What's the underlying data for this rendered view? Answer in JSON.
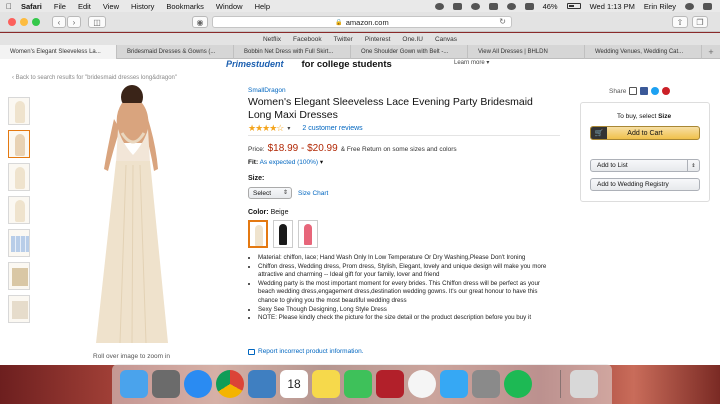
{
  "menubar": {
    "app": "Safari",
    "items": [
      "File",
      "Edit",
      "View",
      "History",
      "Bookmarks",
      "Window",
      "Help"
    ],
    "battery": "46%",
    "clock": "Wed 1:13 PM",
    "user": "Erin Riley"
  },
  "toolbar": {
    "address": "amazon.com"
  },
  "favorites": [
    "Netflix",
    "Facebook",
    "Twitter",
    "Pinterest",
    "One.IU",
    "Canvas"
  ],
  "tabs": [
    "Women's Elegant Sleeveless La...",
    "Bridesmaid Dresses & Gowns (...",
    "Bobbin Net Dress with Full Skirt...",
    "One Shoulder Gown with Belt -...",
    "View All Dresses | BHLDN",
    "Wedding Venues, Wedding Cat..."
  ],
  "page": {
    "prime_logo": "Primestudent",
    "prime_tagline": "for college students",
    "learn_more": "Learn more ▾",
    "back_link": "‹ Back to search results for \"bridesmaid dresses long&dragon\"",
    "zoom_hint": "Roll over image to zoom in",
    "brand": "SmallDragon",
    "title": "Women's Elegant Sleeveless Lace Evening Party Bridesmaid Long Maxi Dresses",
    "stars": "★★★★☆",
    "reviews": "2 customer reviews",
    "price_label": "Price:",
    "price": "$18.99 - $20.99",
    "shipping": "& Free Return on some sizes and colors",
    "fit_label": "Fit:",
    "fit_value": "As expected (100%)",
    "size_label": "Size:",
    "size_select": "Select",
    "size_chart": "Size Chart",
    "color_label": "Color:",
    "color_value": "Beige",
    "swatch_colors": [
      "#efe3cd",
      "#1a1a1a",
      "#e7667a"
    ],
    "bullets": [
      "Material: chiffon, lace; Hand Wash Only In Low Temperature Or Dry Washing,Please Don't Ironing",
      "Chiffon dress, Wedding dress, Prom dress, Stylish, Elegant, lovely and unique design will make you more attractive and charming -- Ideal gift for your family, lover and friend",
      "Wedding party is the most important moment for every brides. This Chiffon dress will be perfect as your beach wedding dress,engagement dress,destination wedding gowns. It's our great honour to have this chance to giving you the most beautiful wedding dress",
      "Sexy See Though Designing, Long Style Dress",
      "NOTE: Please kindly check the picture for the size detail or the product description before you buy it"
    ],
    "report": "Report incorrect product information.",
    "share": "Share",
    "buybox": {
      "hint_prefix": "To buy, select",
      "hint_bold": "Size",
      "add_to_cart": "Add to Cart",
      "add_to_list": "Add to List",
      "add_to_registry": "Add to Wedding Registry"
    }
  },
  "dock": {
    "apps": [
      "finder-icon",
      "launchpad-icon",
      "safari-icon",
      "chrome-icon",
      "preview-icon",
      "calendar-icon",
      "notes-icon",
      "facetime-icon",
      "photo-booth-icon",
      "photos-icon",
      "messages-icon",
      "system-preferences-icon",
      "spotify-icon",
      "trash-icon"
    ],
    "calendar_day": "18"
  }
}
